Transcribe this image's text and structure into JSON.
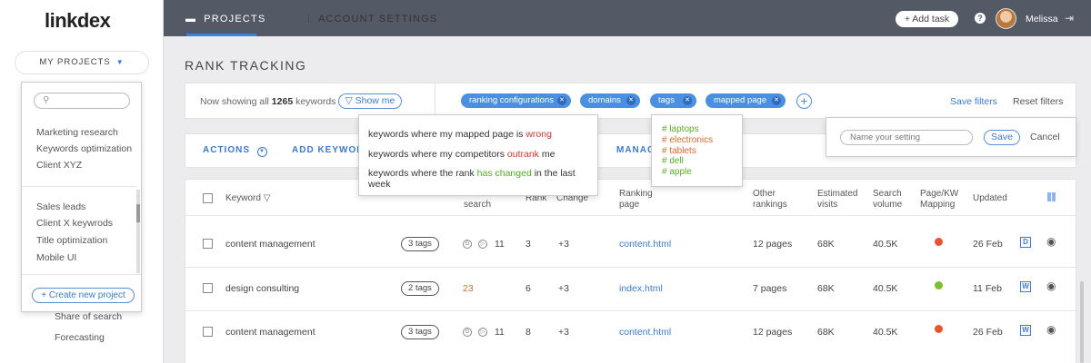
{
  "app": {
    "logo": "linkdex"
  },
  "sidebar": {
    "my_projects_label": "MY PROJECTS",
    "links_behind": [
      "Share of search",
      "Forecasting"
    ],
    "project_dropdown": {
      "search_placeholder": "",
      "group1": [
        "Marketing research",
        "Keywords optimization",
        "Client XYZ"
      ],
      "group2": [
        "Sales  leads",
        "Client X keywrods",
        "Title optimization",
        "Mobile UI"
      ],
      "new_project_label": "+ Create new project"
    }
  },
  "topbar": {
    "tabs": [
      {
        "label": "PROJECTS",
        "icon": "folder-icon",
        "active": true
      },
      {
        "label": "ACCOUNT SETTINGS",
        "icon": "sliders-icon",
        "active": false
      }
    ],
    "add_task_label": "+ Add task",
    "help_label": "?",
    "user_name": "Melissa"
  },
  "page": {
    "title": "RANK TRACKING"
  },
  "filters": {
    "now_showing_prefix": "Now showing all",
    "now_showing_count": "1265",
    "now_showing_suffix": "keywords",
    "show_me_label": "Show me",
    "chips": [
      "ranking configurations",
      "domains",
      "tags",
      "mapped page"
    ],
    "save_filters_label": "Save filters",
    "reset_filters_label": "Reset filters"
  },
  "show_me_menu": [
    {
      "prefix": "keywords where my mapped page is",
      "highlight": "wrong",
      "suffix": ""
    },
    {
      "prefix": "keywords where my competitors",
      "highlight": "outrank",
      "suffix": "me"
    },
    {
      "prefix": "keywords where the rank",
      "highlight": "has changed",
      "suffix": "in the last week"
    }
  ],
  "tags_menu": [
    {
      "label": "# laptops",
      "color": "#5aae28"
    },
    {
      "label": "# electronics",
      "color": "#e06a2c"
    },
    {
      "label": "# tablets",
      "color": "#e06a2c"
    },
    {
      "label": "# dell",
      "color": "#5aae28"
    },
    {
      "label": "# apple",
      "color": "#5aae28"
    }
  ],
  "save_setting": {
    "placeholder": "Name your setting",
    "save_label": "Save",
    "cancel_label": "Cancel"
  },
  "actions": {
    "actions_label": "ACTIONS",
    "add_keyword_label": "ADD KEYWORD",
    "manage_label": "MANAG"
  },
  "table": {
    "headers": {
      "keyword": "Keyword",
      "search": "search",
      "rank": "Rank",
      "change": "Change",
      "ranking_page": "Ranking page",
      "other_rankings": "Other rankings",
      "estimated_visits": "Estimated visits",
      "search_volume": "Search volume",
      "mapping": "Page/KW Mapping",
      "updated": "Updated"
    },
    "rows": [
      {
        "keyword": "content management",
        "tags": "3 tags",
        "search": "11",
        "rank": "3",
        "change": "+3",
        "page": "content.html",
        "other": "12 pages",
        "visits": "68K",
        "volume": "40.5K",
        "mapping_color": "#e8542e",
        "updated": "26 Feb",
        "badge": "D",
        "has_icons": true
      },
      {
        "keyword": "design consulting",
        "tags": "2 tags",
        "search": "23",
        "rank": "6",
        "change": "+3",
        "page": "index.html",
        "other": "7 pages",
        "visits": "68K",
        "volume": "40.5K",
        "mapping_color": "#7ac12b",
        "updated": "11 Feb",
        "badge": "W",
        "has_icons": false
      },
      {
        "keyword": "content management",
        "tags": "3 tags",
        "search": "11",
        "rank": "8",
        "change": "+3",
        "page": "content.html",
        "other": "12 pages",
        "visits": "68K",
        "volume": "40.5K",
        "mapping_color": "#e8542e",
        "updated": "26 Feb",
        "badge": "W",
        "has_icons": true
      }
    ]
  }
}
